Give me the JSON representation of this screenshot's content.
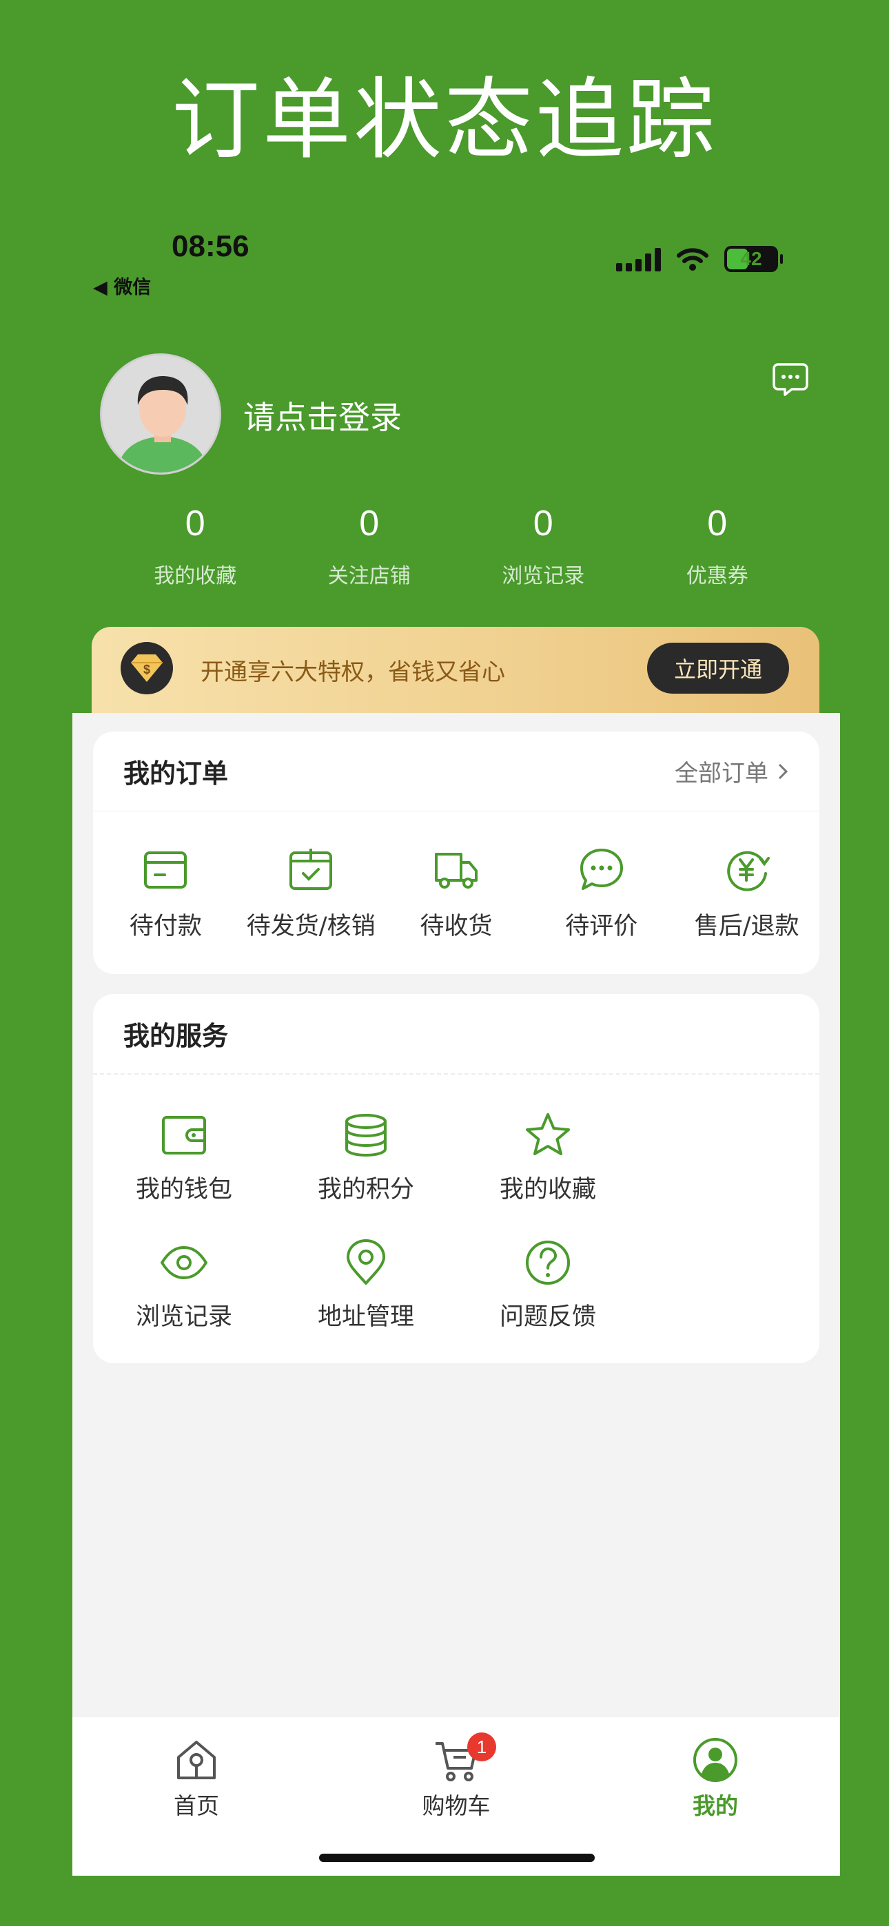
{
  "banner": {
    "title": "订单状态追踪"
  },
  "status_bar": {
    "time": "08:56",
    "back_app": "◀ 微信",
    "battery": "42"
  },
  "profile": {
    "login_prompt": "请点击登录"
  },
  "stats": [
    {
      "value": "0",
      "label": "我的收藏"
    },
    {
      "value": "0",
      "label": "关注店铺"
    },
    {
      "value": "0",
      "label": "浏览记录"
    },
    {
      "value": "0",
      "label": "优惠券"
    }
  ],
  "vip": {
    "text": "开通享六大特权，省钱又省心",
    "button": "立即开通"
  },
  "orders": {
    "title": "我的订单",
    "all_label": "全部订单",
    "items": [
      {
        "label": "待付款",
        "icon": "wallet-card-icon"
      },
      {
        "label": "待发货/核销",
        "icon": "package-check-icon"
      },
      {
        "label": "待收货",
        "icon": "truck-icon"
      },
      {
        "label": "待评价",
        "icon": "chat-bubble-icon"
      },
      {
        "label": "售后/退款",
        "icon": "yen-refund-icon"
      }
    ]
  },
  "services": {
    "title": "我的服务",
    "items": [
      {
        "label": "我的钱包",
        "icon": "wallet-icon"
      },
      {
        "label": "我的积分",
        "icon": "coins-stack-icon"
      },
      {
        "label": "我的收藏",
        "icon": "star-icon"
      },
      {
        "label": "浏览记录",
        "icon": "eye-icon"
      },
      {
        "label": "地址管理",
        "icon": "location-pin-icon"
      },
      {
        "label": "问题反馈",
        "icon": "question-circle-icon"
      }
    ]
  },
  "tabbar": {
    "items": [
      {
        "label": "首页",
        "icon": "home-icon"
      },
      {
        "label": "购物车",
        "icon": "cart-icon",
        "badge": "1"
      },
      {
        "label": "我的",
        "icon": "profile-icon",
        "active": true
      }
    ]
  },
  "colors": {
    "brand": "#4a9a2c",
    "vip_gold": "#f0d08f",
    "badge_red": "#e8392f"
  }
}
